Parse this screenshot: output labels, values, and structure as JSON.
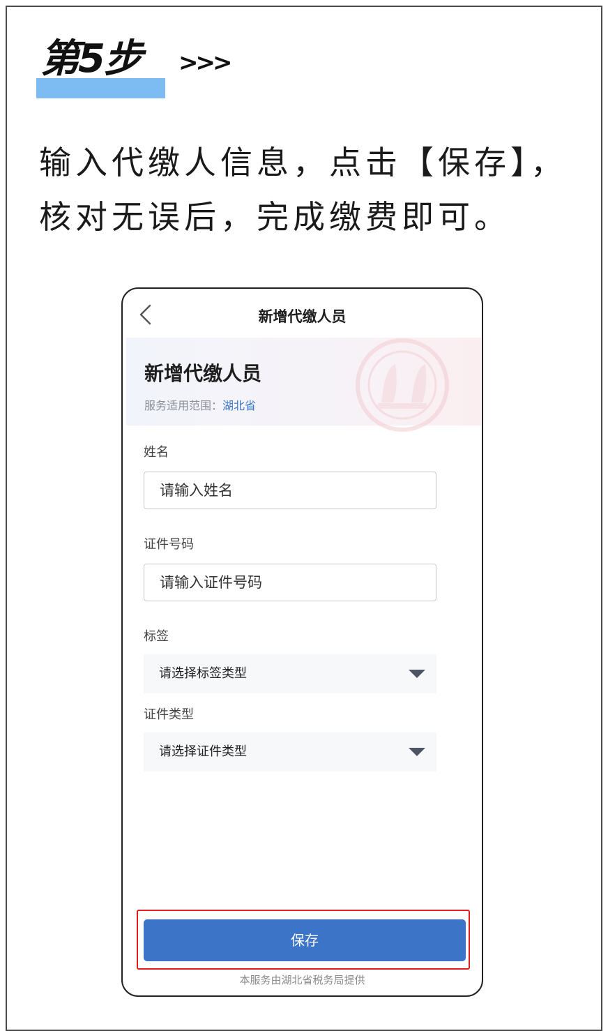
{
  "step": {
    "title": "第5步",
    "arrows": ">>>"
  },
  "instruction": {
    "line1": "输入代缴人信息，点击【保存】，",
    "line2": "核对无误后，完成缴费即可。"
  },
  "phone": {
    "nav_title": "新增代缴人员",
    "banner": {
      "title": "新增代缴人员",
      "scope_label": "服务适用范围：",
      "scope_value": "湖北省"
    },
    "fields": {
      "name_label": "姓名",
      "name_placeholder": "请输入姓名",
      "id_label": "证件号码",
      "id_placeholder": "请输入证件号码",
      "tag_label": "标签",
      "tag_select": "请选择标签类型",
      "idtype_label": "证件类型",
      "idtype_select": "请选择证件类型"
    },
    "save_label": "保存",
    "footer": "本服务由湖北省税务局提供"
  },
  "colors": {
    "accent_blue": "#3c74c8",
    "highlight_red": "#e01b1b",
    "step_underline": "#7cbcf3"
  },
  "icons": [
    "chevron-left-icon",
    "dropdown-caret-icon",
    "tax-seal-icon"
  ]
}
